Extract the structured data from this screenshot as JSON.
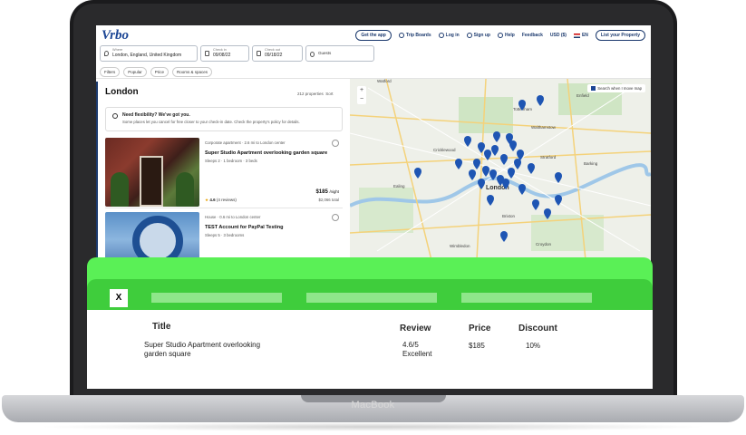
{
  "device": {
    "brand": "MacBook"
  },
  "nav": {
    "logo": "Vrbo",
    "get_app": "Get the app",
    "trip_boards": "Trip Boards",
    "login": "Log in",
    "signup": "Sign up",
    "help": "Help",
    "feedback": "Feedback",
    "currency": "USD ($)",
    "language": "EN",
    "list_property": "List your Property"
  },
  "search": {
    "where_label": "Where",
    "where_value": "London, England, United Kingdom",
    "checkin_label": "Check in",
    "checkin_value": "09/08/22",
    "checkout_label": "Check out",
    "checkout_value": "09/18/22",
    "guests_placeholder": "Guests"
  },
  "filters": [
    "Filters",
    "Popular",
    "Price",
    "Rooms & spaces"
  ],
  "results": {
    "city": "London",
    "count": "212 properties",
    "sort": "Sort",
    "flex_title": "Need flexibility? We've got you.",
    "flex_text": "Some places let you cancel for free closer to your check-in date. Check the property's policy for details."
  },
  "listings": [
    {
      "meta": "Corporate apartment · 2.6 mi to London center",
      "title": "Super Studio Apartment overlooking garden square",
      "details": "Sleeps 2 · 1 bedroom · 3 beds",
      "rating": "4.6",
      "reviews": "(4 reviews)",
      "price": "$185",
      "price_unit": "/night",
      "total": "$2,066 total"
    },
    {
      "meta": "House · 0.6 mi to London center",
      "title": "TEST Account for PayPal Testing",
      "details": "Sleeps 5 · 3 bedrooms"
    }
  ],
  "map": {
    "search_when_move": "Search when I move map",
    "labels": [
      "Watford",
      "Tottenham",
      "Walthamstow",
      "Enfield",
      "Cricklewood",
      "Stratford",
      "Barking",
      "Ealing",
      "London",
      "Brixton",
      "Wimbledon",
      "Croydon"
    ]
  },
  "overlay": {
    "close": "X",
    "headers": {
      "title": "Title",
      "review": "Review",
      "price": "Price",
      "discount": "Discount"
    },
    "row": {
      "title": "Super Studio Apartment overlooking garden square",
      "review_score": "4.6/5",
      "review_text": "Excellent",
      "price": "$185",
      "discount": "10%"
    }
  },
  "colors": {
    "brand": "#1c4695",
    "overlay_green": "#5af056",
    "overlay_strip": "#3fcd3c",
    "pin": "#1e55b3"
  }
}
